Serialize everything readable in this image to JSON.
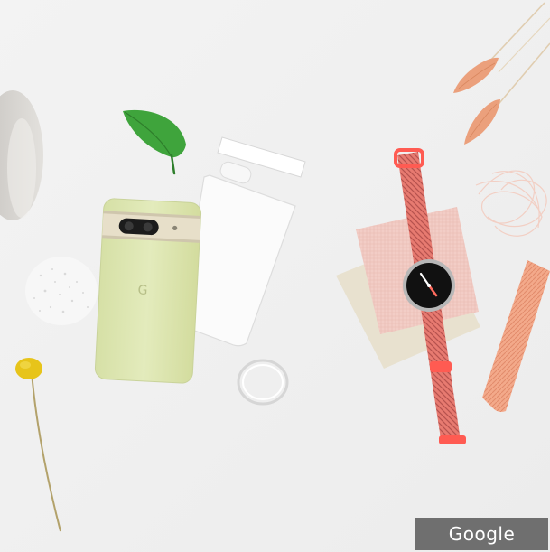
{
  "photo": {
    "description_items": [
      "phone",
      "screen-protector",
      "camera-bar-protector",
      "leaf",
      "watch",
      "watch-band",
      "fabric-swatches",
      "dried-flowers",
      "yellow-flower",
      "glass-ring",
      "fiber-bundle",
      "glitter-pile",
      "stone"
    ],
    "palette": {
      "background": "#f1f1f1",
      "phone": "#dfe8b4",
      "phone_camera_bar": "#e7dfc9",
      "watch_band": "#e7776f",
      "coral_accent": "#ff5b52",
      "leaf": "#3fa43c",
      "yellow_flower": "#e7c41a",
      "dried_flower": "#eba07c",
      "swatch_pink": "#f1cbc4",
      "swatch_cream": "#e8e1cf",
      "band_loose": "#f3a98a"
    },
    "phone_logo": "G"
  },
  "watermark": {
    "label": "Google"
  }
}
